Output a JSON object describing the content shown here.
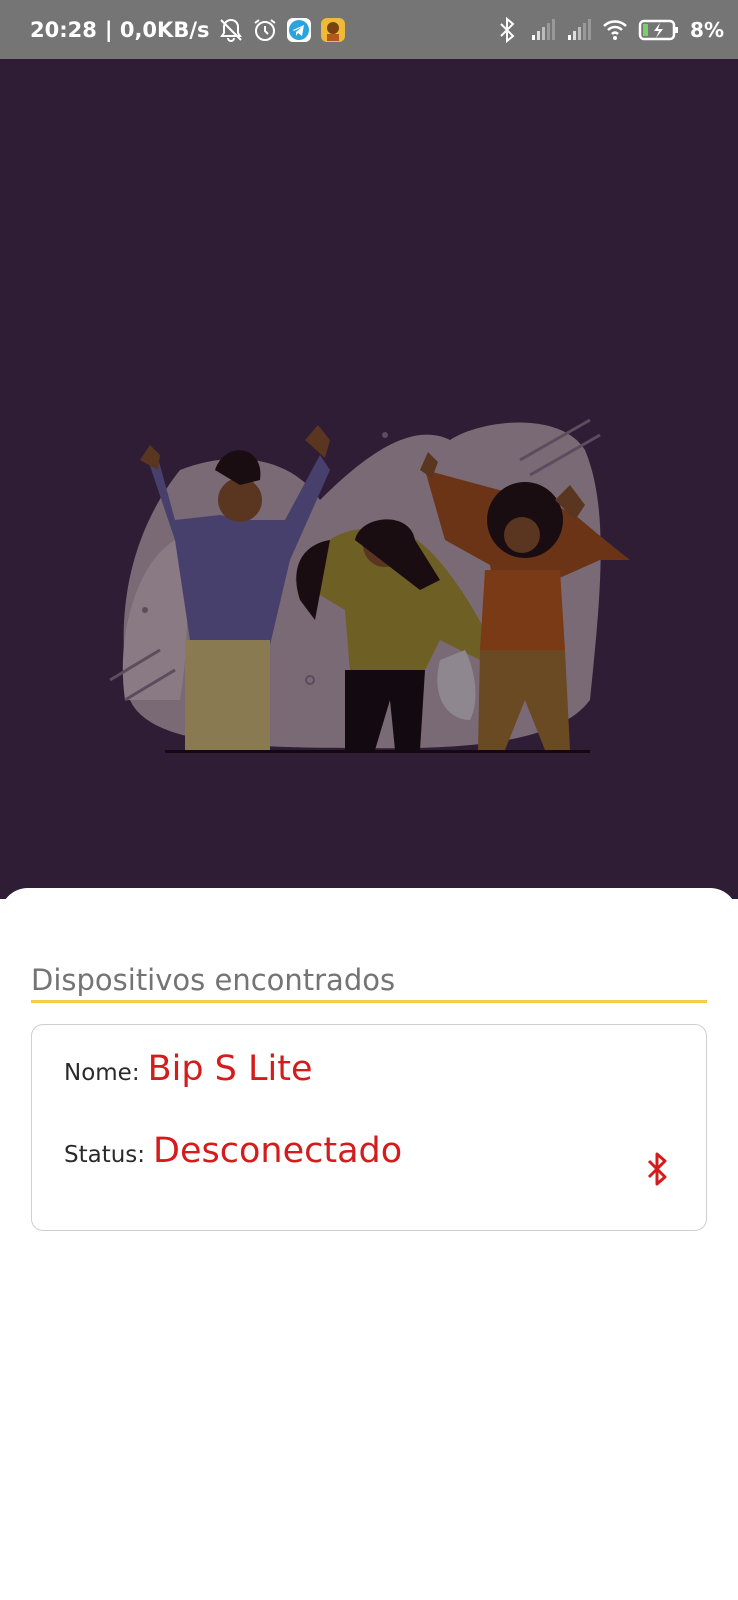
{
  "status_bar": {
    "time": "20:28",
    "network_speed": "| 0,0KB/s",
    "battery": "8%",
    "left_icons": [
      "muted-bell-icon",
      "alarm-icon",
      "telegram-icon",
      "app-avatar-icon"
    ],
    "right_icons": [
      "bluetooth-icon",
      "signal-icon",
      "signal-icon",
      "wifi-icon",
      "battery-charging-icon"
    ]
  },
  "hero": {
    "illustration": "celebrating-people-illustration"
  },
  "devices": {
    "section_title": "Dispositivos encontrados",
    "name_label": "Nome:",
    "name_value": "Bip S Lite",
    "status_label": "Status:",
    "status_value": "Desconectado",
    "action_icon": "bluetooth-icon"
  },
  "colors": {
    "hero_background": "#2f1d36",
    "accent_line": "#f2cf45",
    "value_red": "#d51c1c"
  }
}
